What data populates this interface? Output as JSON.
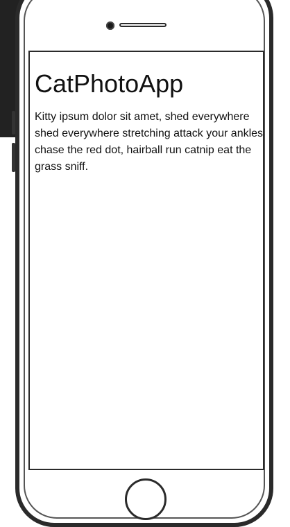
{
  "app": {
    "title": "CatPhotoApp",
    "paragraph": "Kitty ipsum dolor sit amet, shed everywhere shed everywhere stretching attack your ankles chase the red dot, hairball run catnip eat the grass sniff."
  },
  "colors": {
    "device_frame": "#2a2a2a",
    "screen_background": "#ffffff",
    "text": "#111111"
  },
  "icons": {
    "front_camera": "camera-icon",
    "home": "home-button-icon"
  }
}
